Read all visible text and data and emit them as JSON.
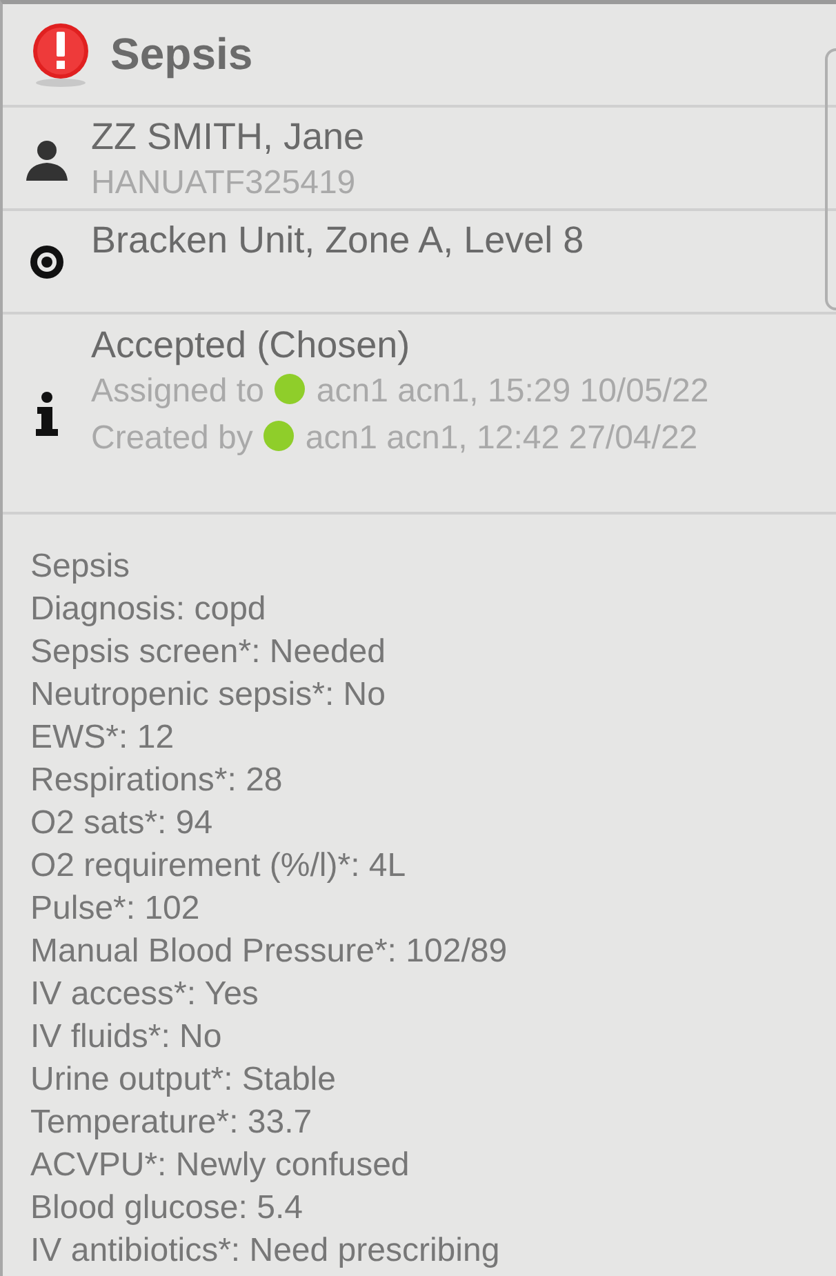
{
  "header": {
    "title": "Sepsis"
  },
  "patient": {
    "name": "ZZ SMITH, Jane",
    "id": "HANUATF325419"
  },
  "location": {
    "text": "Bracken Unit, Zone A, Level 8"
  },
  "status": {
    "state": "Accepted (Chosen)",
    "lines": [
      {
        "label": "Assigned to",
        "color": "#8fce2a",
        "value": "acn1 acn1, 15:29 10/05/22"
      },
      {
        "label": "Created by",
        "color": "#8fce2a",
        "value": "acn1 acn1, 12:42 27/04/22"
      }
    ]
  },
  "details": [
    "Sepsis",
    "Diagnosis: copd",
    "Sepsis screen*: Needed",
    "Neutropenic sepsis*: No",
    "EWS*: 12",
    "Respirations*: 28",
    "O2 sats*: 94",
    "O2 requirement (%/l)*: 4L",
    "Pulse*: 102",
    "Manual Blood Pressure*: 102/89",
    "IV access*: Yes",
    "IV fluids*: No",
    "Urine output*: Stable",
    "Temperature*: 33.7",
    "ACVPU*: Newly confused",
    "Blood glucose: 5.4",
    "IV antibiotics*: Need prescribing"
  ]
}
